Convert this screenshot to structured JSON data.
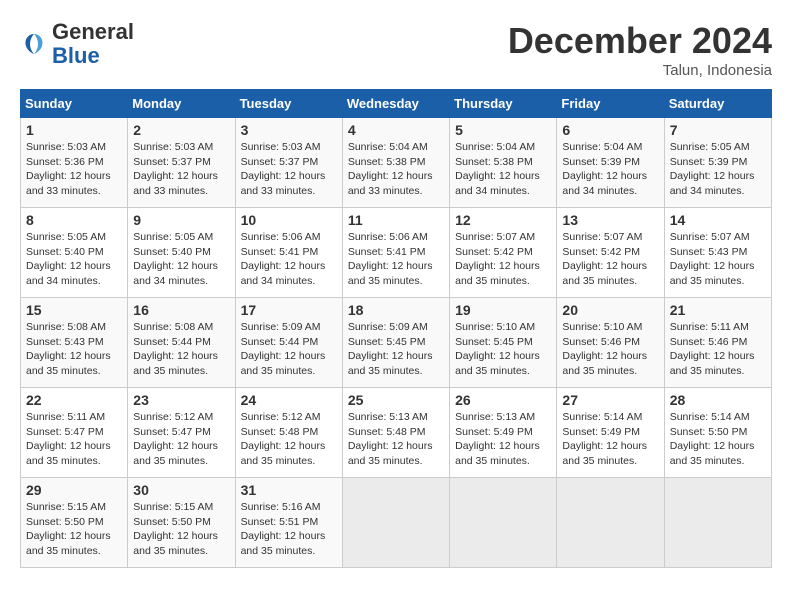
{
  "header": {
    "logo_line1": "General",
    "logo_line2": "Blue",
    "month_year": "December 2024",
    "location": "Talun, Indonesia"
  },
  "weekdays": [
    "Sunday",
    "Monday",
    "Tuesday",
    "Wednesday",
    "Thursday",
    "Friday",
    "Saturday"
  ],
  "weeks": [
    [
      {
        "day": "1",
        "sunrise": "5:03 AM",
        "sunset": "5:36 PM",
        "daylight": "12 hours and 33 minutes."
      },
      {
        "day": "2",
        "sunrise": "5:03 AM",
        "sunset": "5:37 PM",
        "daylight": "12 hours and 33 minutes."
      },
      {
        "day": "3",
        "sunrise": "5:03 AM",
        "sunset": "5:37 PM",
        "daylight": "12 hours and 33 minutes."
      },
      {
        "day": "4",
        "sunrise": "5:04 AM",
        "sunset": "5:38 PM",
        "daylight": "12 hours and 33 minutes."
      },
      {
        "day": "5",
        "sunrise": "5:04 AM",
        "sunset": "5:38 PM",
        "daylight": "12 hours and 34 minutes."
      },
      {
        "day": "6",
        "sunrise": "5:04 AM",
        "sunset": "5:39 PM",
        "daylight": "12 hours and 34 minutes."
      },
      {
        "day": "7",
        "sunrise": "5:05 AM",
        "sunset": "5:39 PM",
        "daylight": "12 hours and 34 minutes."
      }
    ],
    [
      {
        "day": "8",
        "sunrise": "5:05 AM",
        "sunset": "5:40 PM",
        "daylight": "12 hours and 34 minutes."
      },
      {
        "day": "9",
        "sunrise": "5:05 AM",
        "sunset": "5:40 PM",
        "daylight": "12 hours and 34 minutes."
      },
      {
        "day": "10",
        "sunrise": "5:06 AM",
        "sunset": "5:41 PM",
        "daylight": "12 hours and 34 minutes."
      },
      {
        "day": "11",
        "sunrise": "5:06 AM",
        "sunset": "5:41 PM",
        "daylight": "12 hours and 35 minutes."
      },
      {
        "day": "12",
        "sunrise": "5:07 AM",
        "sunset": "5:42 PM",
        "daylight": "12 hours and 35 minutes."
      },
      {
        "day": "13",
        "sunrise": "5:07 AM",
        "sunset": "5:42 PM",
        "daylight": "12 hours and 35 minutes."
      },
      {
        "day": "14",
        "sunrise": "5:07 AM",
        "sunset": "5:43 PM",
        "daylight": "12 hours and 35 minutes."
      }
    ],
    [
      {
        "day": "15",
        "sunrise": "5:08 AM",
        "sunset": "5:43 PM",
        "daylight": "12 hours and 35 minutes."
      },
      {
        "day": "16",
        "sunrise": "5:08 AM",
        "sunset": "5:44 PM",
        "daylight": "12 hours and 35 minutes."
      },
      {
        "day": "17",
        "sunrise": "5:09 AM",
        "sunset": "5:44 PM",
        "daylight": "12 hours and 35 minutes."
      },
      {
        "day": "18",
        "sunrise": "5:09 AM",
        "sunset": "5:45 PM",
        "daylight": "12 hours and 35 minutes."
      },
      {
        "day": "19",
        "sunrise": "5:10 AM",
        "sunset": "5:45 PM",
        "daylight": "12 hours and 35 minutes."
      },
      {
        "day": "20",
        "sunrise": "5:10 AM",
        "sunset": "5:46 PM",
        "daylight": "12 hours and 35 minutes."
      },
      {
        "day": "21",
        "sunrise": "5:11 AM",
        "sunset": "5:46 PM",
        "daylight": "12 hours and 35 minutes."
      }
    ],
    [
      {
        "day": "22",
        "sunrise": "5:11 AM",
        "sunset": "5:47 PM",
        "daylight": "12 hours and 35 minutes."
      },
      {
        "day": "23",
        "sunrise": "5:12 AM",
        "sunset": "5:47 PM",
        "daylight": "12 hours and 35 minutes."
      },
      {
        "day": "24",
        "sunrise": "5:12 AM",
        "sunset": "5:48 PM",
        "daylight": "12 hours and 35 minutes."
      },
      {
        "day": "25",
        "sunrise": "5:13 AM",
        "sunset": "5:48 PM",
        "daylight": "12 hours and 35 minutes."
      },
      {
        "day": "26",
        "sunrise": "5:13 AM",
        "sunset": "5:49 PM",
        "daylight": "12 hours and 35 minutes."
      },
      {
        "day": "27",
        "sunrise": "5:14 AM",
        "sunset": "5:49 PM",
        "daylight": "12 hours and 35 minutes."
      },
      {
        "day": "28",
        "sunrise": "5:14 AM",
        "sunset": "5:50 PM",
        "daylight": "12 hours and 35 minutes."
      }
    ],
    [
      {
        "day": "29",
        "sunrise": "5:15 AM",
        "sunset": "5:50 PM",
        "daylight": "12 hours and 35 minutes."
      },
      {
        "day": "30",
        "sunrise": "5:15 AM",
        "sunset": "5:50 PM",
        "daylight": "12 hours and 35 minutes."
      },
      {
        "day": "31",
        "sunrise": "5:16 AM",
        "sunset": "5:51 PM",
        "daylight": "12 hours and 35 minutes."
      },
      null,
      null,
      null,
      null
    ]
  ],
  "labels": {
    "sunrise": "Sunrise:",
    "sunset": "Sunset:",
    "daylight": "Daylight:"
  }
}
